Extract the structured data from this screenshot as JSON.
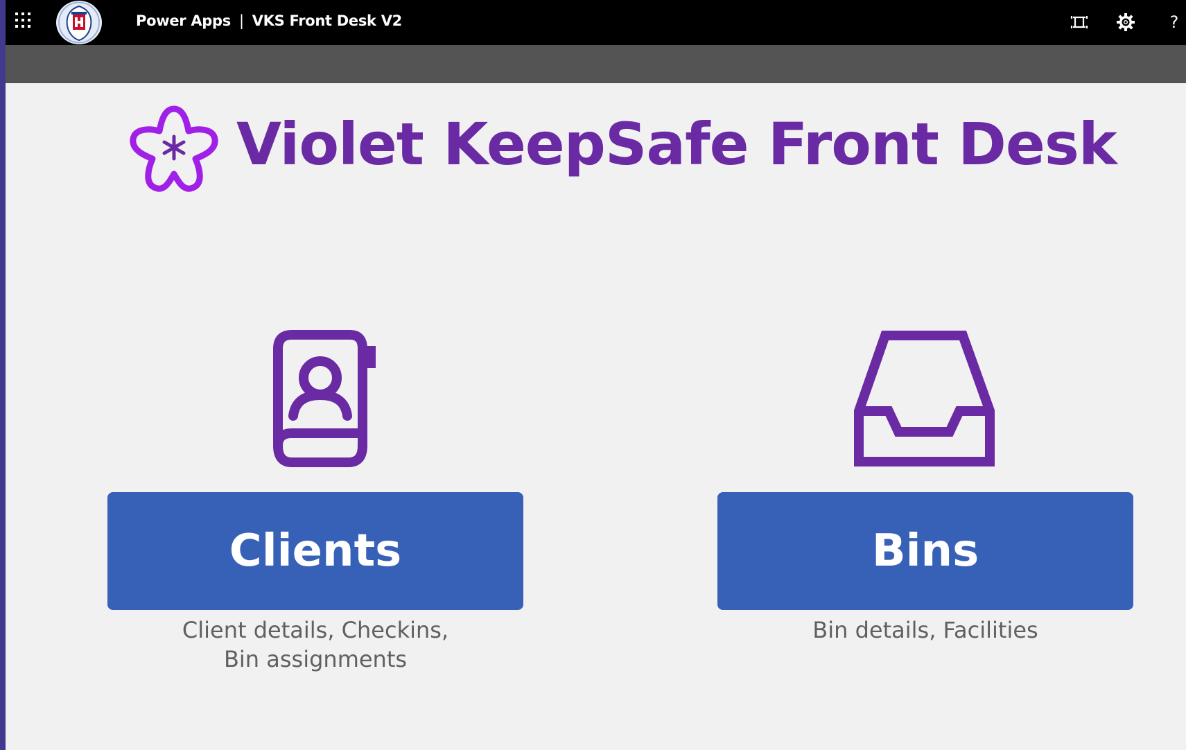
{
  "topbar": {
    "product": "Power Apps",
    "separator": "|",
    "app_name": "VKS Front Desk V2",
    "help_label": "?"
  },
  "header": {
    "title": "Violet KeepSafe Front Desk"
  },
  "cards": {
    "clients": {
      "button_label": "Clients",
      "caption_line1": "Client details, Checkins,",
      "caption_line2": "Bin assignments"
    },
    "bins": {
      "button_label": "Bins",
      "caption_line1": "Bin details, Facilities"
    }
  },
  "colors": {
    "brand_purple": "#6a2aa3",
    "button_blue": "#3761b6",
    "topbar": "#000000",
    "subbar": "#545454",
    "canvas": "#f1f1f1"
  }
}
